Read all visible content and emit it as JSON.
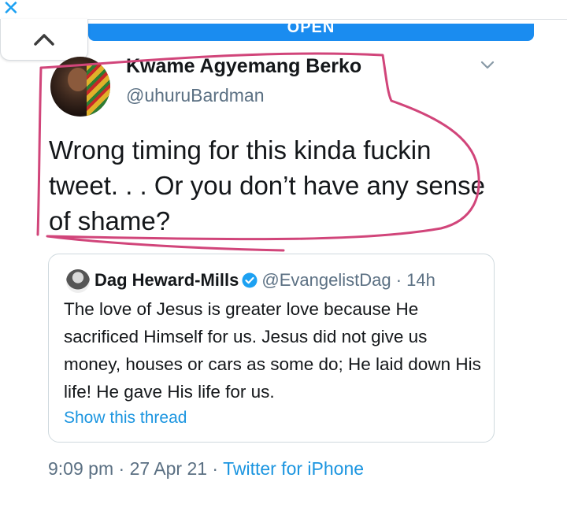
{
  "window": {
    "close_icon": "close-icon",
    "open_label": "OPEN"
  },
  "nav": {
    "back_icon": "chevron-up-icon"
  },
  "tweet": {
    "author_name": "Kwame Agyemang Berko",
    "author_handle": "@uhuruBardman",
    "menu_icon": "chevron-down-icon",
    "text": "Wrong timing for this kinda fuckin tweet. . . Or you don’t have any sense of shame?",
    "timestamp": "9:09 pm",
    "separator": " · ",
    "date": "27 Apr 21",
    "source": "Twitter for iPhone"
  },
  "quoted_tweet": {
    "author_name": "Dag Heward-Mills",
    "verified_icon": "verified-badge-icon",
    "author_handle": "@EvangelistDag",
    "separator": " · ",
    "age": "14h",
    "text": "The love of Jesus is greater love because He sacrificed Himself for us. Jesus did not give us money, houses or cars as some do; He laid down His life! He gave His life for us.",
    "thread_link": "Show this thread"
  },
  "colors": {
    "accent": "#1da1f2",
    "link": "#1b95e0",
    "muted_text": "#5b7083",
    "annotation_stroke": "#d1457a"
  }
}
